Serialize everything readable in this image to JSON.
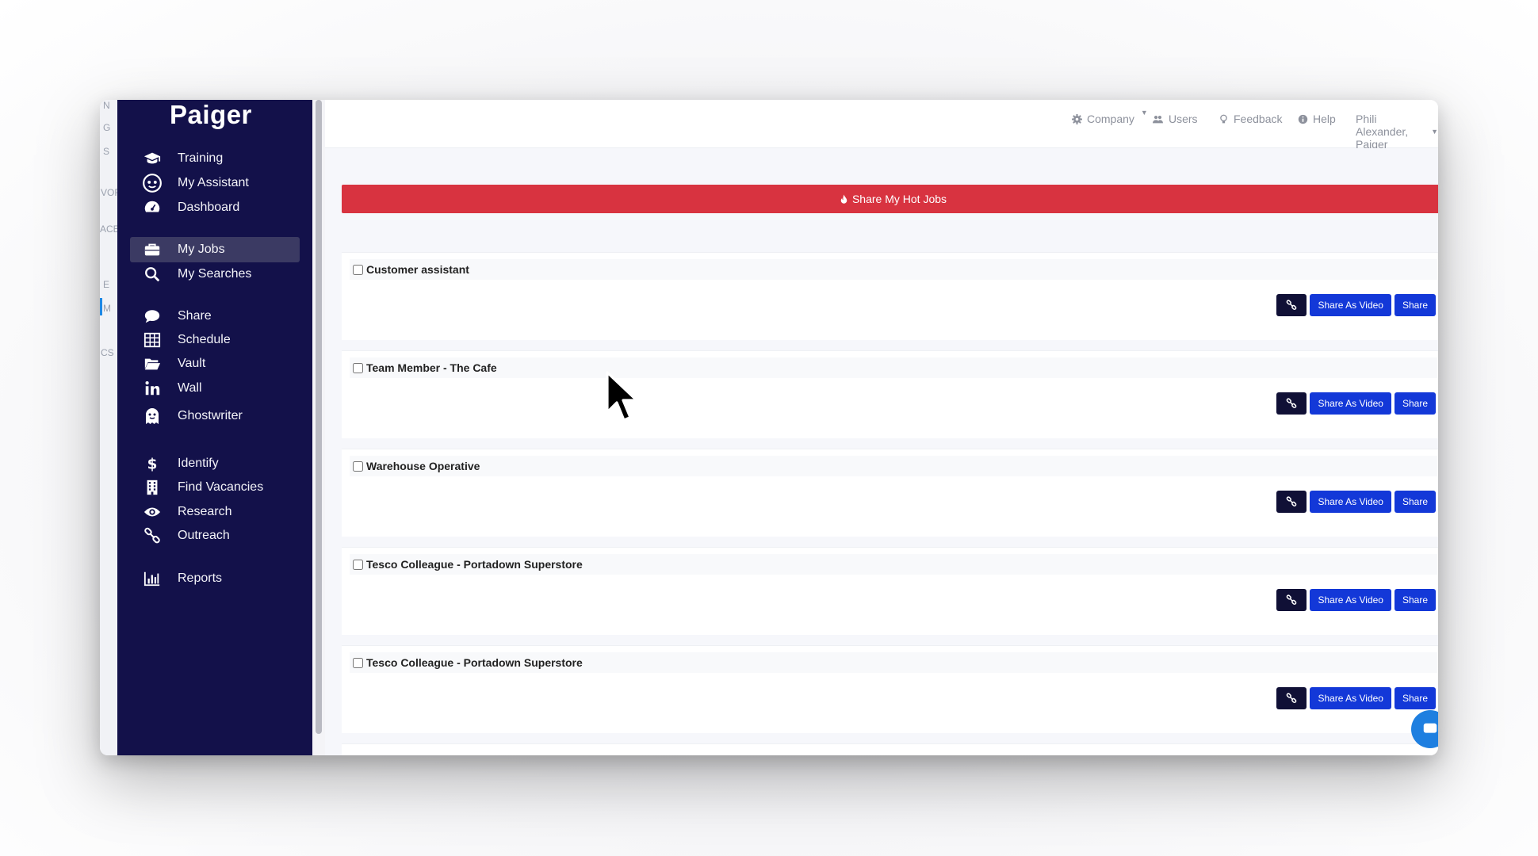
{
  "app": {
    "logo_text": "Paiger"
  },
  "background_window": {
    "peek_letters": [
      "N",
      "G",
      "S",
      "VOR",
      "ACE",
      "E",
      "M",
      "CS"
    ]
  },
  "sidebar": {
    "items": [
      {
        "label": "Training",
        "icon": "graduation-cap-icon"
      },
      {
        "label": "My Assistant",
        "icon": "robot-icon"
      },
      {
        "label": "Dashboard",
        "icon": "dashboard-gauge-icon"
      },
      {
        "label": "My Jobs",
        "icon": "briefcase-icon",
        "active": true
      },
      {
        "label": "My Searches",
        "icon": "search-icon"
      },
      {
        "label": "Share",
        "icon": "chat-bubble-icon"
      },
      {
        "label": "Schedule",
        "icon": "table-grid-icon"
      },
      {
        "label": "Vault",
        "icon": "folder-open-icon"
      },
      {
        "label": "Wall",
        "icon": "linkedin-icon"
      },
      {
        "label": "Ghostwriter",
        "icon": "ghost-icon"
      },
      {
        "label": "Identify",
        "icon": "dollar-icon"
      },
      {
        "label": "Find Vacancies",
        "icon": "building-icon"
      },
      {
        "label": "Research",
        "icon": "eye-icon"
      },
      {
        "label": "Outreach",
        "icon": "link-icon"
      },
      {
        "label": "Reports",
        "icon": "bar-chart-icon"
      }
    ]
  },
  "topbar": {
    "company": "Company",
    "users": "Users",
    "feedback": "Feedback",
    "help": "Help",
    "user_name": "Phili Alexander, Paiger"
  },
  "main": {
    "hot_jobs_button": "Share My Hot Jobs",
    "job_buttons": {
      "link_icon": "link-icon",
      "share_video": "Share As Video",
      "share": "Share"
    },
    "jobs": [
      {
        "title": "Customer assistant"
      },
      {
        "title": "Team Member - The Cafe"
      },
      {
        "title": "Warehouse Operative"
      },
      {
        "title": "Tesco Colleague - Portadown Superstore"
      },
      {
        "title": "Tesco Colleague - Portadown Superstore"
      }
    ]
  },
  "colors": {
    "sidebar_bg": "#13114a",
    "hot_jobs_red": "#d83340",
    "button_blue": "#1338d8",
    "button_dark": "#101036"
  }
}
